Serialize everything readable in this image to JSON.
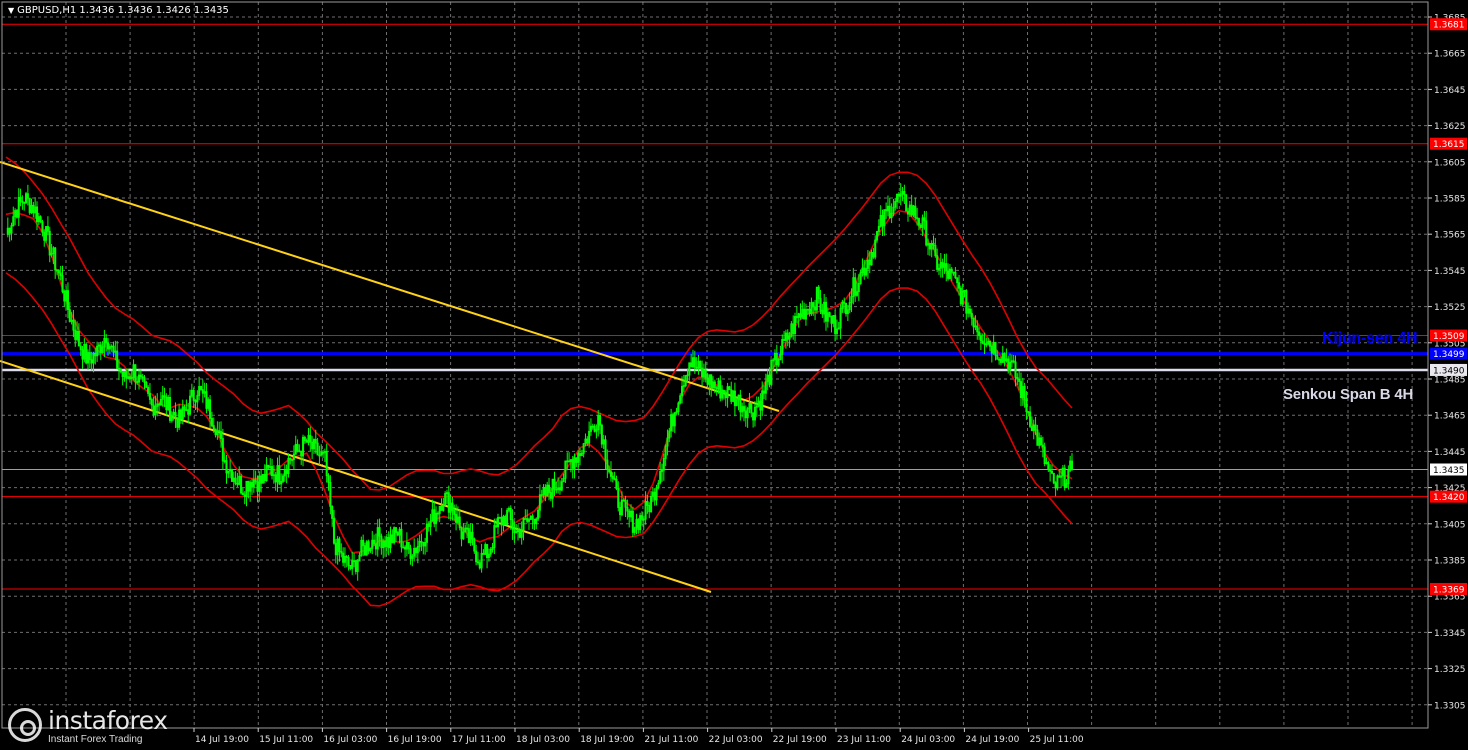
{
  "header": {
    "triangle": "▼",
    "text": "GBPUSD,H1  1.3436 1.3436 1.3426 1.3435"
  },
  "annotations": {
    "kijun": "Kijun-sen 4H",
    "senkou": "Senkou Span B 4H"
  },
  "logo": {
    "brand": "instaforex",
    "tagline": "Instant Forex Trading"
  },
  "colors": {
    "background": "#000000",
    "grid": "#6f6f6f",
    "candle": "#00ff00",
    "level": "#ff0000",
    "bands": "#e00000",
    "trend": "#ffd21a",
    "kijun": "#0000ff",
    "senkou": "#dcdcec"
  },
  "chart_data": {
    "type": "candlestick",
    "symbol": "GBPUSD",
    "timeframe": "H1",
    "ylim": [
      1.33,
      1.3695
    ],
    "y_ticks": [
      "1.3685",
      "1.3665",
      "1.3645",
      "1.3625",
      "1.3605",
      "1.3585",
      "1.3565",
      "1.3545",
      "1.3525",
      "1.3505",
      "1.3485",
      "1.3465",
      "1.3445",
      "1.3425",
      "1.3405",
      "1.3385",
      "1.3365",
      "1.3345",
      "1.3325",
      "1.3305"
    ],
    "x_ticks": [
      "14 Jul 19:00",
      "15 Jul 11:00",
      "16 Jul 03:00",
      "16 Jul 19:00",
      "17 Jul 11:00",
      "18 Jul 03:00",
      "18 Jul 19:00",
      "21 Jul 11:00",
      "22 Jul 03:00",
      "22 Jul 19:00",
      "23 Jul 11:00",
      "24 Jul 03:00",
      "24 Jul 19:00",
      "25 Jul 11:00"
    ],
    "current_price": {
      "value": 1.3435,
      "label": "1.3435"
    },
    "levels": [
      {
        "value": 1.3681,
        "label": "1.3681"
      },
      {
        "value": 1.3615,
        "label": "1.3615"
      },
      {
        "value": 1.3509,
        "label": "1.3509"
      },
      {
        "value": 1.342,
        "label": "1.3420"
      },
      {
        "value": 1.3369,
        "label": "1.3369"
      }
    ],
    "kijun_sen_4h": {
      "value": 1.3499,
      "label": "1.3499"
    },
    "senkou_span_b_4h": {
      "value": 1.349,
      "label": "1.3490"
    },
    "trendlines": [
      {
        "from": [
          "12 Jul 23:00",
          1.3605
        ],
        "to": [
          "22 Jul 07:00",
          1.3469
        ]
      },
      {
        "from": [
          "12 Jul 23:00",
          1.3492
        ],
        "to": [
          "21 Jul 06:00",
          1.3372
        ]
      }
    ],
    "price_path": [
      [
        1.3565,
        1.3578,
        1.3585,
        1.358,
        1.357,
        1.3555,
        1.354,
        1.352,
        1.3505,
        1.3495,
        1.35,
        1.351,
        1.3495,
        1.3485,
        1.349,
        1.348,
        1.347,
        1.3475,
        1.3468,
        1.3462,
        1.347,
        1.348,
        1.3472,
        1.346,
        1.344,
        1.3432,
        1.3425,
        1.343,
        1.3428,
        1.3435,
        1.3432,
        1.344,
        1.3445,
        1.345,
        1.3445,
        1.344,
        1.3395,
        1.3385,
        1.338,
        1.339,
        1.3395,
        1.3398,
        1.3395,
        1.34,
        1.339,
        1.3392,
        1.34,
        1.341,
        1.342,
        1.3415,
        1.34,
        1.3395,
        1.3385,
        1.339,
        1.3405,
        1.341,
        1.34,
        1.3405,
        1.341,
        1.342,
        1.3425,
        1.343,
        1.344,
        1.3445,
        1.3455,
        1.3465,
        1.344,
        1.342,
        1.341,
        1.3405,
        1.341,
        1.342,
        1.344,
        1.346,
        1.348,
        1.3495,
        1.349,
        1.3485,
        1.348,
        1.3478,
        1.3475,
        1.347,
        1.3468,
        1.3475,
        1.349,
        1.35,
        1.351,
        1.352,
        1.3525,
        1.353,
        1.352,
        1.3515,
        1.3525,
        1.3535,
        1.3545,
        1.3555,
        1.357,
        1.358,
        1.3585,
        1.358,
        1.3575,
        1.3565,
        1.355,
        1.3545,
        1.354,
        1.353,
        1.352,
        1.351,
        1.3505,
        1.35,
        1.3495,
        1.3485,
        1.347,
        1.3455,
        1.344,
        1.3425,
        1.343,
        1.3435
      ]
    ]
  }
}
